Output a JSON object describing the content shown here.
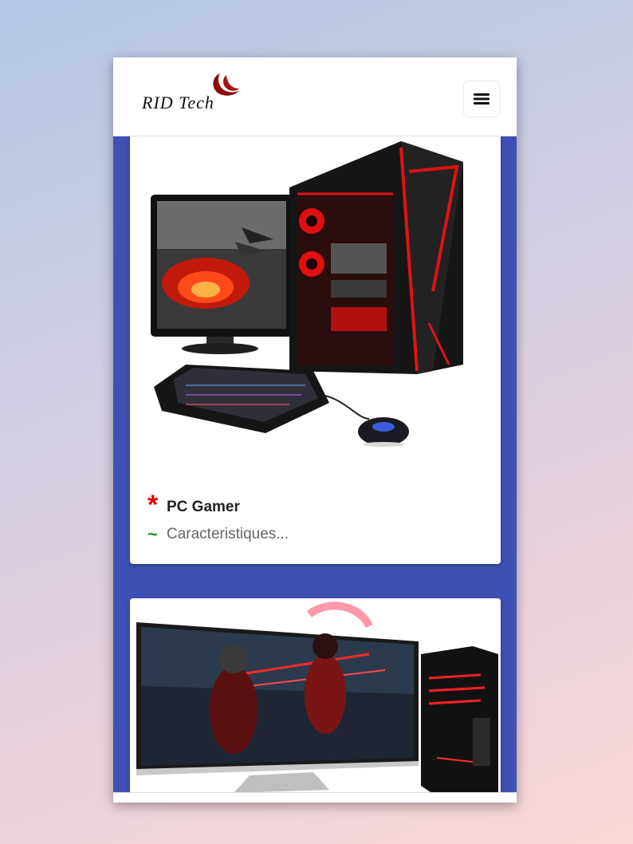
{
  "brand": {
    "name": "RID Tech",
    "accent": "#8b0a0a"
  },
  "navbar": {
    "menu_icon": "hamburger-icon"
  },
  "theme": {
    "content_bg": "#3f51b5",
    "star_color": "#e60000",
    "tilde_color": "#1a8f2e"
  },
  "products": [
    {
      "marker": "*",
      "title": "PC Gamer",
      "sub_marker": "~",
      "subtitle": "Caracteristiques..."
    }
  ]
}
